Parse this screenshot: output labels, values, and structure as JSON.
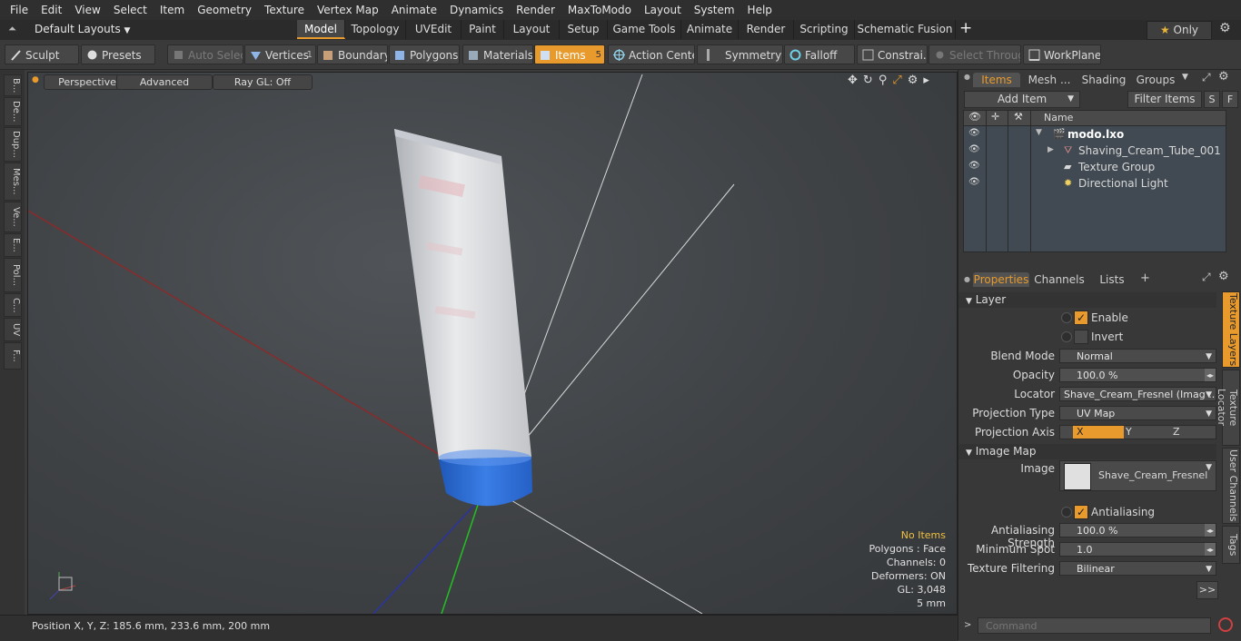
{
  "menu": [
    "File",
    "Edit",
    "View",
    "Select",
    "Item",
    "Geometry",
    "Texture",
    "Vertex Map",
    "Animate",
    "Dynamics",
    "Render",
    "MaxToModo",
    "Layout",
    "System",
    "Help"
  ],
  "layouts": {
    "default_label": "Default Layouts",
    "tabs": [
      "Model",
      "Topology",
      "UVEdit",
      "Paint",
      "Layout",
      "Setup",
      "Game Tools",
      "Animate",
      "Render",
      "Scripting",
      "Schematic Fusion"
    ],
    "active_tab": "Model",
    "add": "+",
    "only_label": "Only"
  },
  "toolbar": {
    "sculpt": "Sculpt",
    "presets": "Presets",
    "auto_select": "Auto Select",
    "vertices": "Vertices",
    "vertices_count": "1",
    "boundary": "Boundary",
    "polygons": "Polygons",
    "materials": "Materials",
    "items": "Items",
    "items_count": "5",
    "action_center": "Action Center",
    "symmetry": "Symmetry",
    "falloff": "Falloff",
    "constraints": "Constrai...",
    "select_through": "Select Through",
    "workplane": "WorkPlane"
  },
  "left_tabs": [
    "B...",
    "De...",
    "Dup...",
    "Mes...",
    "Ve...",
    "E...",
    "Pol...",
    "C...",
    "UV",
    "F..."
  ],
  "viewport": {
    "perspective": "Perspective",
    "advanced": "Advanced",
    "raygl": "Ray GL: Off",
    "info": {
      "no_items": "No Items",
      "polygons": "Polygons : Face",
      "channels": "Channels: 0",
      "deformers": "Deformers: ON",
      "gl": "GL: 3,048",
      "scale": "5 mm"
    }
  },
  "status": {
    "position": "Position X, Y, Z:   185.6 mm, 233.6 mm, 200 mm",
    "command_placeholder": "Command"
  },
  "items_panel": {
    "tabs": [
      "Items",
      "Mesh ...",
      "Shading",
      "Groups"
    ],
    "add_item": "Add Item",
    "filter_items": "Filter Items",
    "s_btn": "S",
    "f_btn": "F",
    "name_header": "Name",
    "tree": [
      {
        "label": "modo.lxo"
      },
      {
        "label": "Shaving_Cream_Tube_001"
      },
      {
        "label": "Texture Group"
      },
      {
        "label": "Directional Light"
      }
    ]
  },
  "properties": {
    "tabs": [
      "Properties",
      "Channels",
      "Lists"
    ],
    "section_layer": "Layer",
    "enable": "Enable",
    "invert": "Invert",
    "blend_mode_label": "Blend Mode",
    "blend_mode": "Normal",
    "opacity_label": "Opacity",
    "opacity": "100.0 %",
    "locator_label": "Locator",
    "locator": "Shave_Cream_Fresnel (Imag ...",
    "projection_type_label": "Projection Type",
    "projection_type": "UV Map",
    "projection_axis_label": "Projection Axis",
    "axis": [
      "X",
      "Y",
      "Z"
    ],
    "section_image_map": "Image Map",
    "image_label": "Image",
    "image": "Shave_Cream_Fresnel",
    "antialiasing": "Antialiasing",
    "aa_strength_label": "Antialiasing Strength",
    "aa_strength": "100.0 %",
    "min_spot_label": "Minimum Spot",
    "min_spot": "1.0",
    "tex_filter_label": "Texture Filtering",
    "tex_filter": "Bilinear",
    "more": ">>",
    "side_tabs": [
      "Texture Layers",
      "Texture Locator",
      "User Channels",
      "Tags"
    ]
  },
  "colors": {
    "accent": "#e89a2c",
    "cap_blue": "#2f6fd6"
  }
}
